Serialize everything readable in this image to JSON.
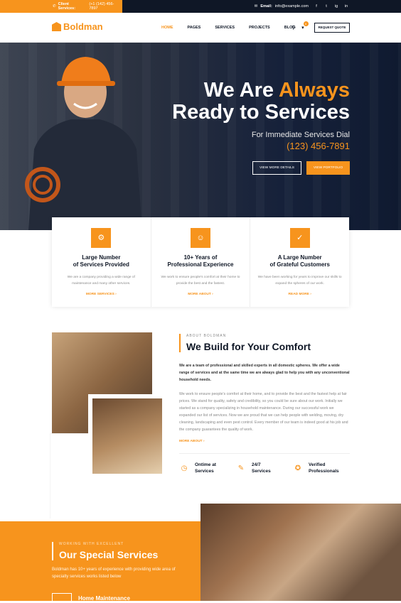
{
  "topbar": {
    "client_label": "Client Services:",
    "client_phone": "(+1 (142) 456-7897",
    "email_label": "Email:",
    "email_value": "info@example.com",
    "social": [
      "f",
      "t",
      "ig",
      "in"
    ]
  },
  "brand": {
    "logo_text": "Boldman",
    "accent": "#f7941d",
    "dark": "#0f1726"
  },
  "nav": {
    "items": [
      "HOME",
      "PAGES",
      "SERVICES",
      "PROJECTS",
      "BLOG"
    ],
    "active": "HOME",
    "cart_count": "0",
    "quote_label": "REQUEST QUOTE",
    "search_icon": "search-icon",
    "cart_icon": "cart-icon"
  },
  "hero": {
    "line1_prefix": "We Are ",
    "line1_accent": "Always",
    "line2": "Ready to Services",
    "subtitle": "For Immediate Services Dial",
    "phone": "(123) 456-7891",
    "btn_details": "VIEW MORE DETAILS",
    "btn_portfolio": "VIEW PORTFOLIO"
  },
  "features": [
    {
      "icon": "gear-icon",
      "title1": "Large Number",
      "title2": "of Services Provided",
      "text": "We are a company providing a wide range of maintenance and many other services.",
      "more": "MORE SERVICES"
    },
    {
      "icon": "user-icon",
      "title1": "10+ Years of",
      "title2": "Professional Experience",
      "text": "We work to ensure people's comfort at their home to provide the best and the fastest.",
      "more": "MORE ABOUT"
    },
    {
      "icon": "thumbs-up-icon",
      "title1": "A Large Number",
      "title2": "of Grateful Customers",
      "text": "We have been working for years to improve our skills to expand the spheres of our work.",
      "more": "READ MORE"
    }
  ],
  "about": {
    "kicker": "ABOUT BOLDMAN",
    "title": "We Build for Your Comfort",
    "lead": "We are a team of professional and skilled experts in all domestic spheres. We offer a wide range of services and at the same time we are always glad to help you with any unconventional household needs.",
    "body": "We work to ensure people's comfort at their home, and to provide the best and the fastest help at fair prices. We stand for quality, safety and credibility, so you could be sure about our work. Initially we started as a company specializing in household maintenance. During our successful work we expanded our list of services. Now we are proud that we can help people with welding, moving, dry cleaning, landscaping and even pest control. Every member of our team is indeed good at his job and the company guarantees the quality of work.",
    "more": "MORE ABOUT",
    "stats": [
      {
        "icon": "clock-icon",
        "l1": "Ontime at",
        "l2": "Services"
      },
      {
        "icon": "tools-icon",
        "l1": "24/7",
        "l2": "Services"
      },
      {
        "icon": "medal-icon",
        "l1": "Verified",
        "l2": "Professionals"
      }
    ]
  },
  "services": {
    "kicker": "WORKING WITH EXCELLENT",
    "title": "Our Special Services",
    "text": "Boldman has 10+ years of experience with providing wide area of specialty services works listed below",
    "first_item": "Home Maintenance"
  }
}
